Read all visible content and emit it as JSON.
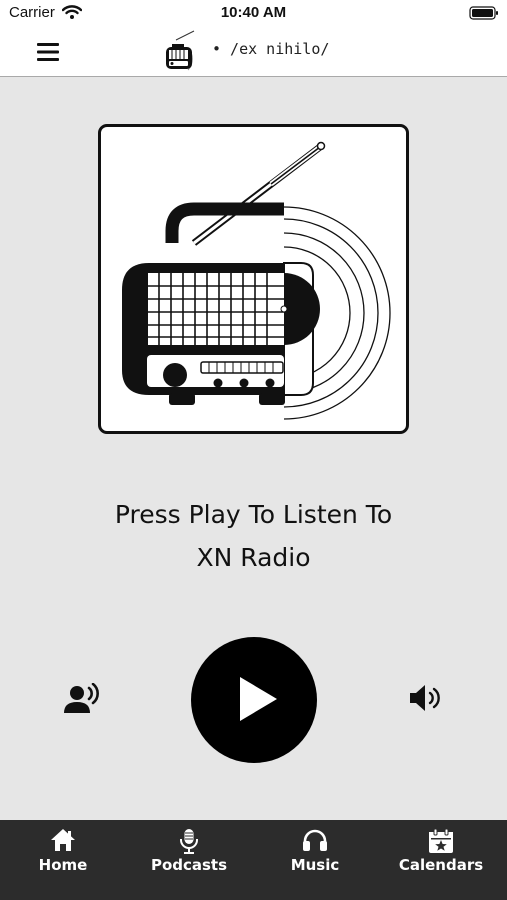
{
  "status_bar": {
    "carrier": "Carrier",
    "time": "10:40 AM"
  },
  "header": {
    "title": "• /ex nihilo/",
    "menu_icon": "hamburger-menu-icon",
    "logo_icon": "radio-logo-icon"
  },
  "main": {
    "artwork_icon": "vintage-radio-icon",
    "headline_line1": "Press Play To Listen To",
    "headline_line2": "XN Radio"
  },
  "controls": {
    "speaker_icon": "speaking-person-icon",
    "play_icon": "play-icon",
    "volume_icon": "volume-icon"
  },
  "tab_bar": {
    "tabs": [
      {
        "label": "Home",
        "icon": "home-icon"
      },
      {
        "label": "Podcasts",
        "icon": "microphone-icon"
      },
      {
        "label": "Music",
        "icon": "headphones-icon"
      },
      {
        "label": "Calendars",
        "icon": "calendar-star-icon"
      }
    ]
  },
  "colors": {
    "page_background": "#e6e6e6",
    "bar_background": "#ffffff",
    "tab_bar_background": "#2c2c2c",
    "foreground": "#111111"
  }
}
